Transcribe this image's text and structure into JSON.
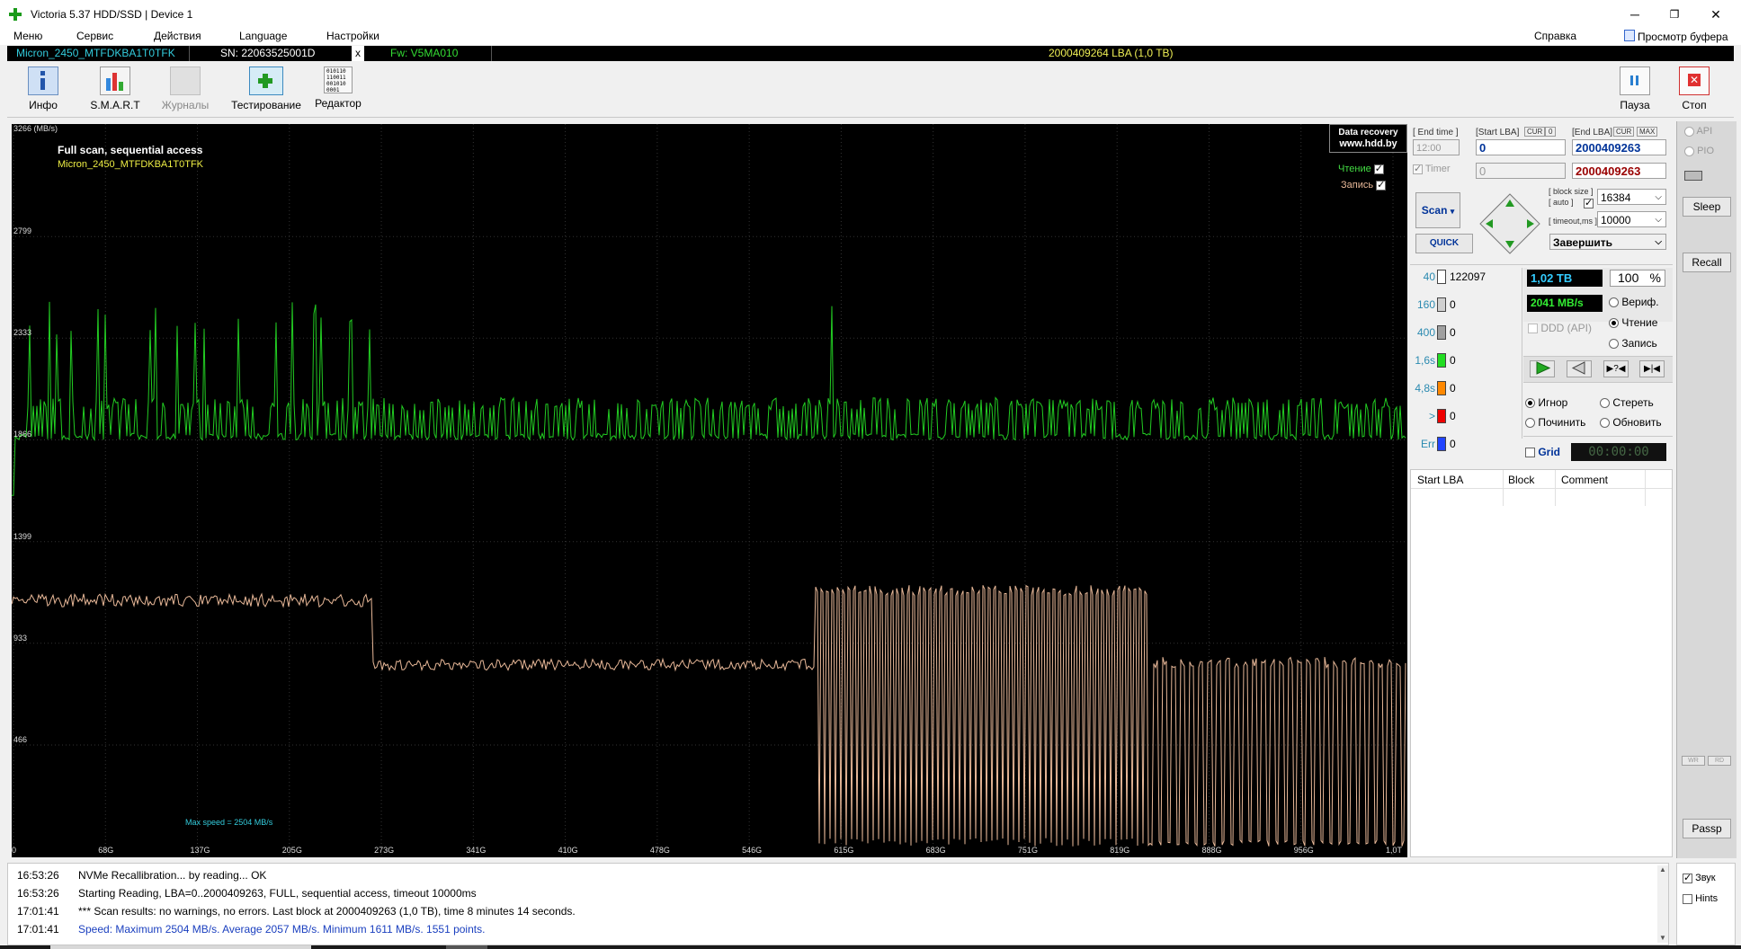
{
  "window": {
    "title": "Victoria 5.37 HDD/SSD | Device 1",
    "minimize": "─",
    "restore": "❐",
    "close": "✕"
  },
  "menu": {
    "items": [
      "Меню",
      "Сервис",
      "Действия",
      "Language",
      "Настройки"
    ],
    "help": "Справка",
    "clipboard": "Просмотр буфера"
  },
  "device": {
    "model": "Micron_2450_MTFDKBA1T0TFK",
    "serial": "SN: 22063525001D",
    "x": "x",
    "firmware": "Fw: V5MA010",
    "capacity": "2000409264 LBA (1,0 TB)"
  },
  "toolbar": {
    "info": "Инфо",
    "smart": "S.M.A.R.T",
    "logs": "Журналы",
    "test": "Тестирование",
    "editor": "Редактор",
    "pause": "Пауза",
    "stop": "Стоп"
  },
  "graph": {
    "ymax_label": "3266 (MB/s)",
    "title": "Full scan, sequential access",
    "device": "Micron_2450_MTFDKBA1T0TFK",
    "watermark1": "Data recovery",
    "watermark2": "www.hdd.by",
    "legend_read": "Чтение",
    "legend_write": "Запись",
    "max_speed": "Max speed = 2504 MB/s",
    "y_ticks": [
      "2799",
      "2333",
      "1866",
      "1399",
      "933",
      "466"
    ],
    "x_ticks": [
      "0",
      "68G",
      "137G",
      "205G",
      "273G",
      "341G",
      "410G",
      "478G",
      "546G",
      "615G",
      "683G",
      "751G",
      "819G",
      "888G",
      "956G",
      "1,0T"
    ],
    "read_color": "#22cc22",
    "write_color": "#e8b898"
  },
  "controls": {
    "end_time_label": "[ End time ]",
    "end_time_value": "12:00",
    "timer_label": "Timer",
    "start_lba_label": "[Start LBA]",
    "cur_label": "CUR",
    "zero_label": "0",
    "end_lba_label": "[End LBA]",
    "max_label": "MAX",
    "start_lba": "0",
    "start_lba2": "0",
    "end_lba": "2000409263",
    "end_lba2": "2000409263",
    "scan": "Scan",
    "quick": "QUICK",
    "block_size_label": "[ block size ]",
    "auto_label": "[ auto ]",
    "timeout_label": "[ timeout,ms ]",
    "block_size": "16384",
    "timeout": "10000",
    "finish": "Завершить",
    "histogram": [
      {
        "label": "40",
        "count": "122097",
        "color": "#ffffff"
      },
      {
        "label": "160",
        "count": "0",
        "color": "#d0d0d0"
      },
      {
        "label": "400",
        "count": "0",
        "color": "#a0a0a0"
      },
      {
        "label": "1,6s",
        "count": "0",
        "color": "#22dd22"
      },
      {
        "label": "4,8s",
        "count": "0",
        "color": "#ff8800"
      },
      {
        "label": ">",
        "count": "0",
        "color": "#ee0000"
      },
      {
        "label": "Err",
        "count": "0",
        "color": "#2244ff"
      }
    ],
    "size_done": "1,02 TB",
    "percent": "100",
    "percent_sign": "%",
    "speed": "2041 MB/s",
    "ddd": "DDD (API)",
    "verify": "Вериф.",
    "read": "Чтение",
    "write": "Запись",
    "ignore": "Игнор",
    "erase": "Стереть",
    "repair": "Починить",
    "refresh": "Обновить",
    "grid": "Grid",
    "elapsed": "00:00:00"
  },
  "table": {
    "headers": [
      "Start LBA",
      "Block",
      "Comment"
    ]
  },
  "side": {
    "api": "API",
    "pio": "PIO",
    "sleep": "Sleep",
    "recall": "Recall",
    "wr": "WR",
    "rd": "RD",
    "passp": "Passp",
    "sound": "Звук",
    "hints": "Hints"
  },
  "log": [
    {
      "time": "16:53:26",
      "text": "NVMe Recallibration...  by reading... OK",
      "color": "#000000"
    },
    {
      "time": "16:53:26",
      "text": "Starting Reading, LBA=0..2000409263, FULL, sequential access, timeout 10000ms",
      "color": "#000000"
    },
    {
      "time": "17:01:41",
      "text": "*** Scan results: no warnings, no errors. Last block at 2000409263 (1,0 TB), time 8 minutes 14 seconds.",
      "color": "#000000"
    },
    {
      "time": "17:01:41",
      "text": "Speed: Maximum 2504 MB/s. Average 2057 MB/s. Minimum 1611 MB/s. 1551 points.",
      "color": "#1a3fbf"
    }
  ]
}
